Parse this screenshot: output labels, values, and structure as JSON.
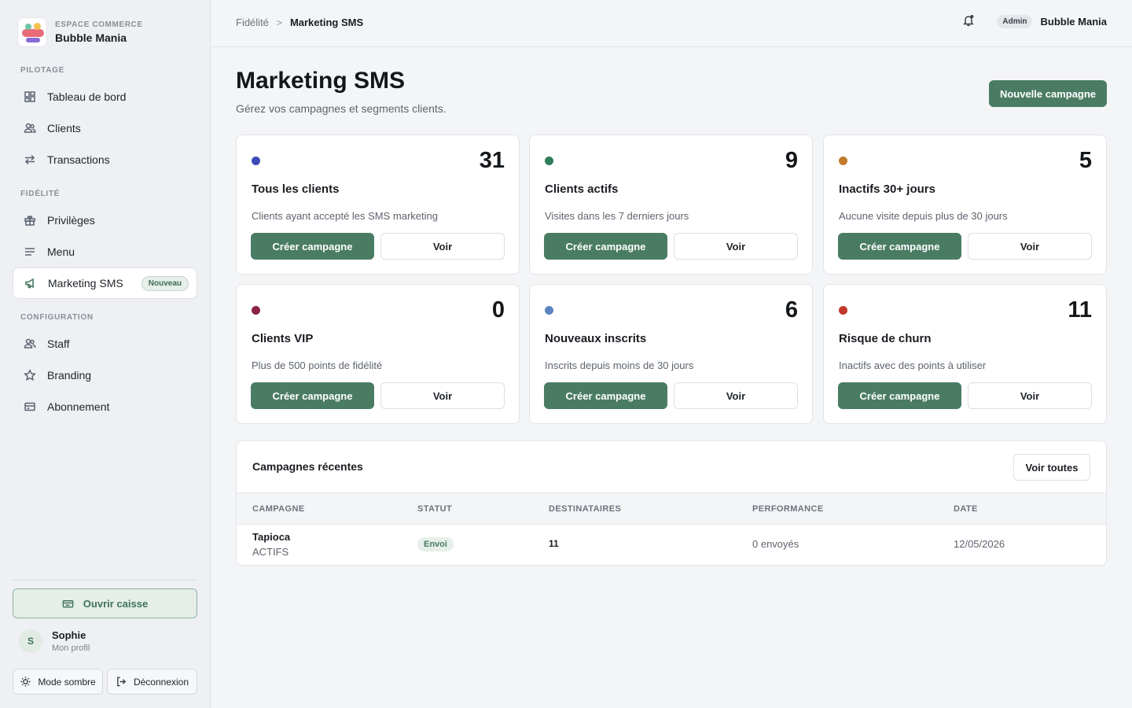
{
  "sidebar": {
    "brand": {
      "small": "ESPACE COMMERCE",
      "name": "Bubble Mania"
    },
    "sections": {
      "pilotage": "PILOTAGE",
      "fidelite": "FIDÉLITÉ",
      "configuration": "CONFIGURATION"
    },
    "items": {
      "dashboard": "Tableau de bord",
      "clients": "Clients",
      "transactions": "Transactions",
      "privileges": "Privilèges",
      "menu": "Menu",
      "marketing": "Marketing SMS",
      "marketing_badge": "Nouveau",
      "staff": "Staff",
      "branding": "Branding",
      "subscription": "Abonnement"
    },
    "open_cash": "Ouvrir caisse",
    "profile": {
      "initial": "S",
      "name": "Sophie",
      "sub": "Mon profil"
    },
    "dark_mode": "Mode sombre",
    "logout": "Déconnexion"
  },
  "topbar": {
    "crumb_parent": "Fidélité",
    "crumb_sep": ">",
    "crumb_current": "Marketing SMS",
    "role": "Admin",
    "user": "Bubble Mania"
  },
  "page": {
    "title": "Marketing SMS",
    "subtitle": "Gérez vos campagnes et segments clients.",
    "new_campaign": "Nouvelle campagne"
  },
  "segments": [
    {
      "count": "31",
      "title": "Tous les clients",
      "desc": "Clients ayant accepté les SMS marketing",
      "color": "#3b4bb5",
      "create": "Créer campagne",
      "view": "Voir"
    },
    {
      "count": "9",
      "title": "Clients actifs",
      "desc": "Visites dans les 7 derniers jours",
      "color": "#2e7d58",
      "create": "Créer campagne",
      "view": "Voir"
    },
    {
      "count": "5",
      "title": "Inactifs 30+ jours",
      "desc": "Aucune visite depuis plus de 30 jours",
      "color": "#c27a2c",
      "create": "Créer campagne",
      "view": "Voir"
    },
    {
      "count": "0",
      "title": "Clients VIP",
      "desc": "Plus de 500 points de fidélité",
      "color": "#8a2347",
      "create": "Créer campagne",
      "view": "Voir"
    },
    {
      "count": "6",
      "title": "Nouveaux inscrits",
      "desc": "Inscrits depuis moins de 30 jours",
      "color": "#5b86c2",
      "create": "Créer campagne",
      "view": "Voir"
    },
    {
      "count": "11",
      "title": "Risque de churn",
      "desc": "Inactifs avec des points à utiliser",
      "color": "#c0392b",
      "create": "Créer campagne",
      "view": "Voir"
    }
  ],
  "recent": {
    "title": "Campagnes récentes",
    "view_all": "Voir toutes",
    "columns": [
      "CAMPAGNE",
      "STATUT",
      "DESTINATAIRES",
      "PERFORMANCE",
      "DATE"
    ],
    "rows": [
      {
        "name": "Tapioca",
        "segment": "ACTIFS",
        "status": "Envoi",
        "recipients": "11",
        "performance": "0 envoyés",
        "date": "12/05/2026"
      }
    ]
  }
}
